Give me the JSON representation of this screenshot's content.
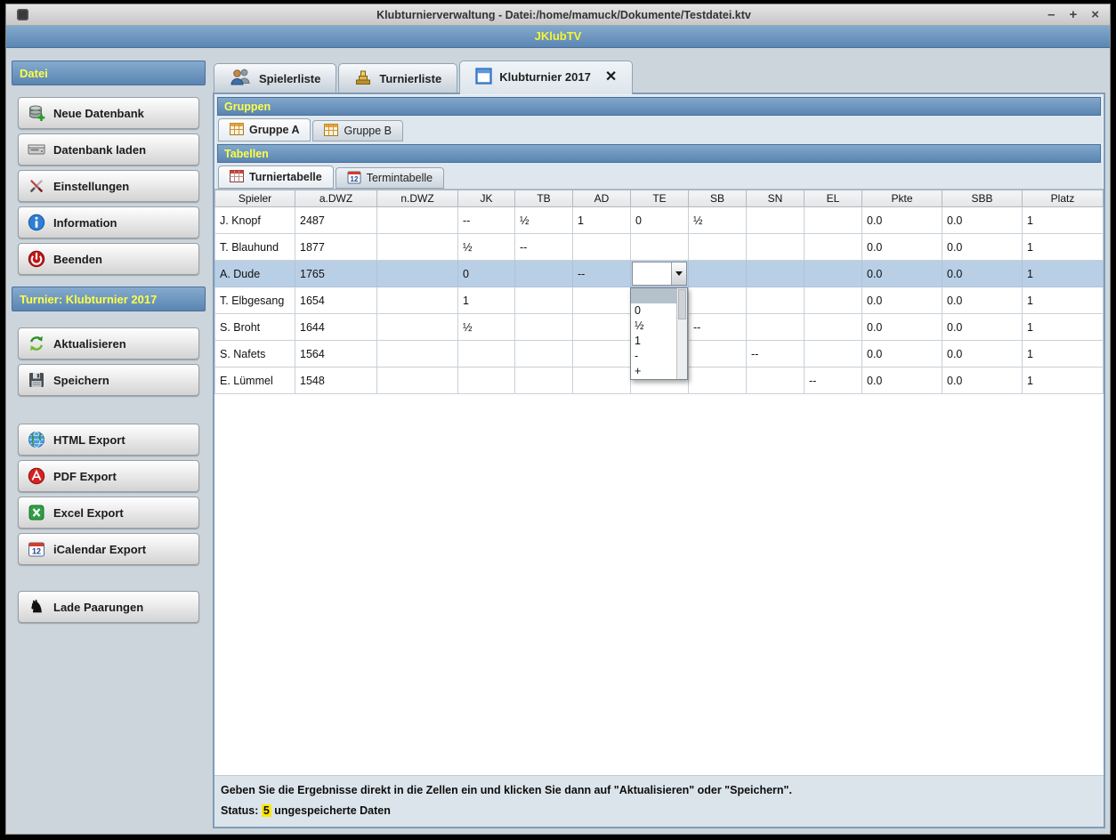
{
  "window": {
    "title": "Klubturnierverwaltung - Datei:/home/mamuck/Dokumente/Testdatei.ktv",
    "controls": {
      "minimize": "–",
      "maximize": "+",
      "close": "×"
    }
  },
  "header": {
    "app_name": "JKlubTV"
  },
  "icons": {
    "knight": "♞",
    "tab_close": "✕"
  },
  "sidebar": {
    "datei_header": "Datei",
    "datei_buttons": [
      {
        "label": "Neue Datenbank",
        "icon": "database-add-icon"
      },
      {
        "label": "Datenbank laden",
        "icon": "database-load-icon"
      },
      {
        "label": "Einstellungen",
        "icon": "settings-icon"
      },
      {
        "label": "Information",
        "icon": "info-icon"
      },
      {
        "label": "Beenden",
        "icon": "power-icon"
      }
    ],
    "turnier_header": "Turnier: Klubturnier 2017",
    "turnier_buttons": [
      {
        "label": "Aktualisieren",
        "icon": "refresh-icon"
      },
      {
        "label": "Speichern",
        "icon": "save-icon"
      }
    ],
    "export_buttons": [
      {
        "label": "HTML Export",
        "icon": "globe-icon"
      },
      {
        "label": "PDF Export",
        "icon": "pdf-icon"
      },
      {
        "label": "Excel Export",
        "icon": "excel-icon"
      },
      {
        "label": "iCalendar Export",
        "icon": "calendar-icon"
      }
    ],
    "pairing_buttons": [
      {
        "label": "Lade Paarungen",
        "icon": "knight-icon"
      }
    ]
  },
  "main_tabs": [
    {
      "label": "Spielerliste",
      "active": false
    },
    {
      "label": "Turnierliste",
      "active": false
    },
    {
      "label": "Klubturnier 2017",
      "active": true,
      "closable": true
    }
  ],
  "gruppen": {
    "header": "Gruppen",
    "tabs": [
      {
        "label": "Gruppe A",
        "active": true
      },
      {
        "label": "Gruppe B",
        "active": false
      }
    ]
  },
  "tabellen": {
    "header": "Tabellen",
    "tabs": [
      {
        "label": "Turniertabelle",
        "active": true
      },
      {
        "label": "Termintabelle",
        "active": false
      }
    ]
  },
  "table": {
    "columns": [
      "Spieler",
      "a.DWZ",
      "n.DWZ",
      "JK",
      "TB",
      "AD",
      "TE",
      "SB",
      "SN",
      "EL",
      "Pkte",
      "SBB",
      "Platz"
    ],
    "rows": [
      [
        "J. Knopf",
        "2487",
        "",
        "--",
        "½",
        "1",
        "0",
        "½",
        "",
        "",
        "0.0",
        "0.0",
        "1"
      ],
      [
        "T. Blauhund",
        "1877",
        "",
        "½",
        "--",
        "",
        "",
        "",
        "",
        "",
        "0.0",
        "0.0",
        "1"
      ],
      [
        "A. Dude",
        "1765",
        "",
        "0",
        "",
        "--",
        "",
        "",
        "",
        "",
        "0.0",
        "0.0",
        "1"
      ],
      [
        "T. Elbgesang",
        "1654",
        "",
        "1",
        "",
        "",
        "",
        "",
        "",
        "",
        "0.0",
        "0.0",
        "1"
      ],
      [
        "S. Broht",
        "1644",
        "",
        "½",
        "",
        "",
        "",
        "--",
        "",
        "",
        "0.0",
        "0.0",
        "1"
      ],
      [
        "S. Nafets",
        "1564",
        "",
        "",
        "",
        "",
        "",
        "",
        "--",
        "",
        "0.0",
        "0.0",
        "1"
      ],
      [
        "E. Lümmel",
        "1548",
        "",
        "",
        "",
        "",
        "",
        "",
        "",
        "--",
        "0.0",
        "0.0",
        "1"
      ]
    ],
    "selected_row": 2,
    "editor": {
      "row": 2,
      "col": 6,
      "value": "",
      "options": [
        "",
        "0",
        "½",
        "1",
        "-",
        "+"
      ]
    }
  },
  "status": {
    "instruction": "Geben Sie die Ergebnisse direkt in die Zellen ein und klicken Sie dann auf \"Aktualisieren\" oder \"Speichern\".",
    "status_prefix": "Status: ",
    "unsaved_count": "5",
    "status_suffix": " ungespeicherte Daten"
  }
}
